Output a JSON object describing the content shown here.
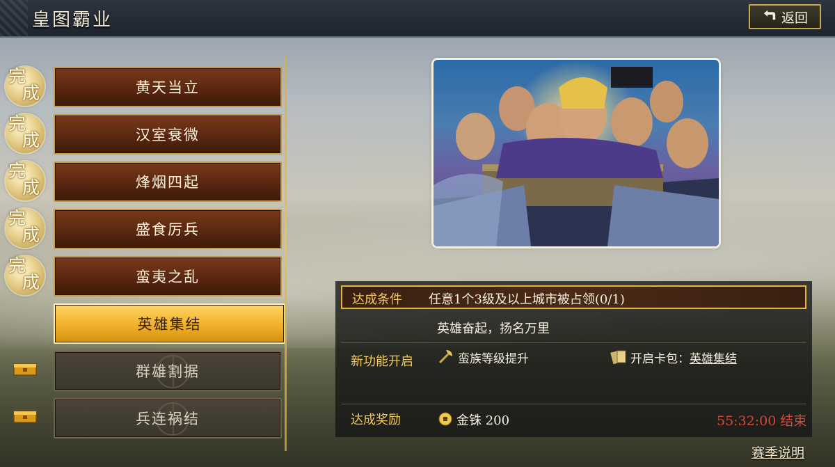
{
  "header": {
    "title": "皇图霸业",
    "back_label": "返回"
  },
  "stages": [
    {
      "label": "黄天当立",
      "state": "completed",
      "badge": "完成"
    },
    {
      "label": "汉室衰微",
      "state": "completed",
      "badge": "完成"
    },
    {
      "label": "烽烟四起",
      "state": "completed",
      "badge": "完成"
    },
    {
      "label": "盛食厉兵",
      "state": "completed",
      "badge": "完成"
    },
    {
      "label": "蛮夷之乱",
      "state": "completed",
      "badge": "完成"
    },
    {
      "label": "英雄集结",
      "state": "active"
    },
    {
      "label": "群雄割据",
      "state": "locked"
    },
    {
      "label": "兵连祸结",
      "state": "locked"
    }
  ],
  "detail": {
    "condition_label": "达成条件",
    "condition_text": "任意1个3级及以上城市被占领(0/1)",
    "flavor_text": "英雄奋起，扬名万里",
    "unlock_label": "新功能开启",
    "unlock_feature_1": "蛮族等级提升",
    "unlock_feature_2_prefix": "开启卡包：",
    "unlock_feature_2_link": "英雄集结",
    "reward_label": "达成奖励",
    "reward_item": "金铢",
    "reward_amount": "200",
    "timer": "55:32:00 结束"
  },
  "footer": {
    "season_info": "赛季说明"
  },
  "colors": {
    "gold": "#f1c95b",
    "timer_red": "#d24a3a",
    "active_stage": "#f0b12a",
    "brown_stage": "#5a2710"
  }
}
